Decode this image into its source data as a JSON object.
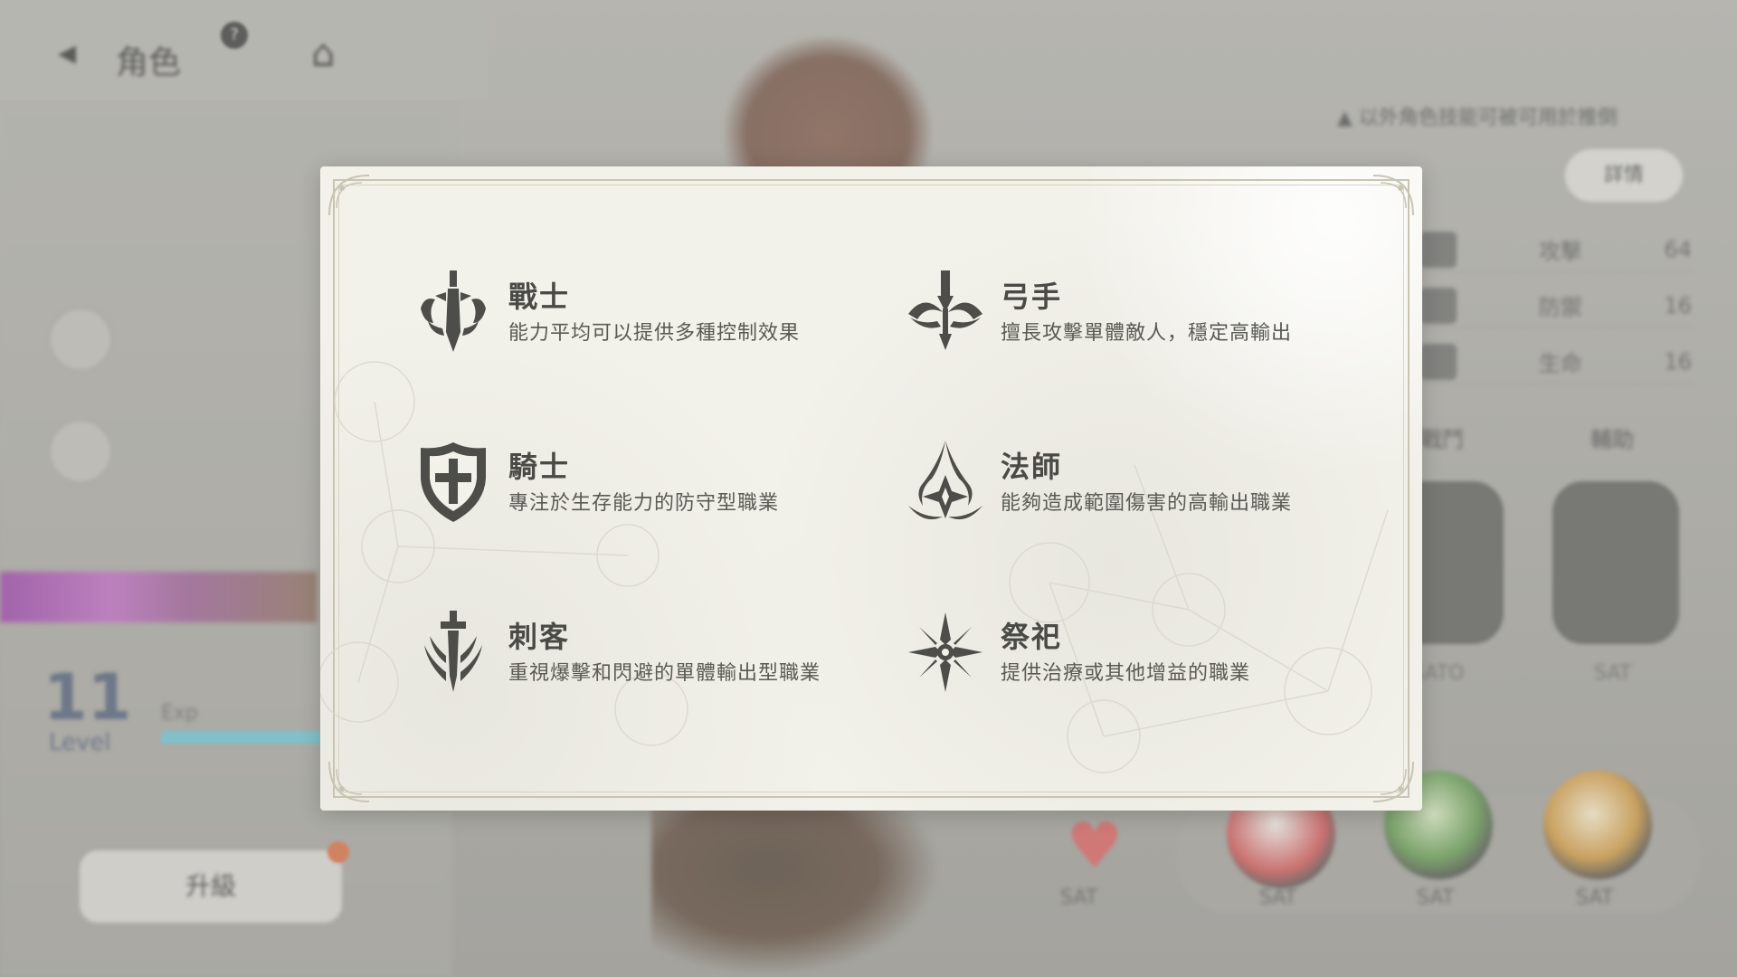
{
  "background": {
    "header": {
      "title": "角色",
      "help_glyph": "?",
      "back_glyph": "◂",
      "home_glyph": "⌂"
    },
    "notice_text": "▲ 以外角色技能可被可用於推倒",
    "detail_button_label": "詳情",
    "stats": [
      {
        "label": "攻擊",
        "value": "64"
      },
      {
        "label": "防禦",
        "value": "16"
      },
      {
        "label": "生命",
        "value": "16"
      }
    ],
    "slots": {
      "left_label": "戰鬥",
      "right_label": "輔助",
      "left_sub": "SATO",
      "right_sub": "SAT"
    },
    "level": {
      "value": "11",
      "label": "Level"
    },
    "exp_label": "Exp",
    "upgrade_button_label": "升級",
    "orb_labels": [
      "SAT",
      "SAT",
      "SAT",
      "SAT"
    ]
  },
  "modal": {
    "classes": [
      {
        "name": "戰士",
        "description": "能力平均可以提供多種控制效果",
        "icon": "warrior-icon"
      },
      {
        "name": "弓手",
        "description": "擅長攻擊單體敵人，穩定高輸出",
        "icon": "archer-icon"
      },
      {
        "name": "騎士",
        "description": "專注於生存能力的防守型職業",
        "icon": "knight-icon"
      },
      {
        "name": "法師",
        "description": "能夠造成範圍傷害的高輸出職業",
        "icon": "mage-icon"
      },
      {
        "name": "刺客",
        "description": "重視爆擊和閃避的單體輸出型職業",
        "icon": "assassin-icon"
      },
      {
        "name": "祭祀",
        "description": "提供治療或其他增益的職業",
        "icon": "priest-icon"
      }
    ]
  },
  "colors": {
    "modal_bg": "#f2f1ea",
    "frame": "#c9c4b2",
    "icon": "#4d4d49",
    "title_text": "#4a4a46",
    "desc_text": "#5a5a55"
  }
}
